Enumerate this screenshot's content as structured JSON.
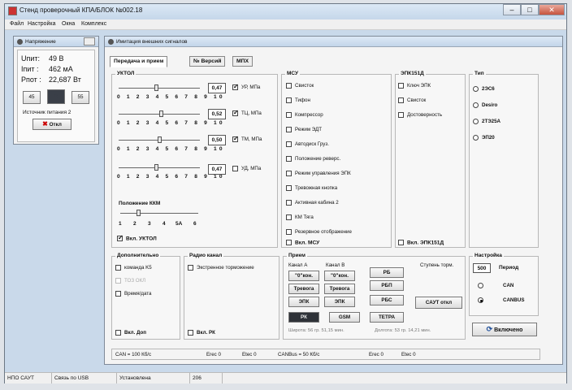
{
  "window": {
    "title": "Стенд проверочный КПА/БЛОК №002.18",
    "menu": [
      "Файл",
      "Настройка",
      "Окна",
      "Комплекс"
    ]
  },
  "power": {
    "title": "Напряжение",
    "u_label": "Uпит:",
    "u_value": "49 В",
    "i_label": "Iпит :",
    "i_value": "462 мА",
    "p_label": "Pпот :",
    "p_value": "22,687 Вт",
    "btn_45": "45",
    "btn_75": "75",
    "btn_55": "55",
    "source": "Источник питания 2",
    "off_button": "Откл"
  },
  "imitation": {
    "title": "Имитация внешних сигналов",
    "tabs": [
      "Передача и прием",
      "№ Версий",
      "МПХ"
    ],
    "uktol": {
      "title": "УКТОЛ",
      "ticks": "0 1 2 3 4 5 6 7 8 9 10",
      "sliders": [
        {
          "value": "0,47",
          "label": "УР, МПа",
          "checked": true
        },
        {
          "value": "0,52",
          "label": "ТЦ, МПа",
          "checked": true
        },
        {
          "value": "0,50",
          "label": "ТМ, МПа",
          "checked": true
        },
        {
          "value": "0,47",
          "label": "УД, МПа",
          "checked": false
        }
      ],
      "kkm_title": "Положение ККМ",
      "kkm_ticks": [
        "1",
        "2",
        "3",
        "4",
        "5А",
        "6"
      ],
      "enable": "Вкл. УКТОЛ"
    },
    "msu": {
      "title": "МСУ",
      "items": [
        "Свисток",
        "Тифон",
        "Компрессор",
        "Режим ЭДТ",
        "Автодиск Груз.",
        "Положение реверс.",
        "Режим управления ЭПК",
        "Тревожная кнопка",
        "Активная кабина 2",
        "КМ Тяга",
        "Резервное отображение"
      ],
      "enable": "Вкл. МСУ"
    },
    "epk": {
      "title": "ЭПК151Д",
      "items": [
        "Ключ ЭПК",
        "Свисток",
        "Достоверность"
      ],
      "enable": "Вкл. ЭПК151Д"
    },
    "type": {
      "title": "Тип",
      "items": [
        "2ЭС6",
        "Desiro",
        "2ТЭ25А",
        "ЭП20"
      ]
    },
    "extra": {
      "title": "Дополнительно",
      "items": [
        "команда K5",
        "ТОЗ ОКЛ",
        "Время/дата"
      ],
      "enable": "Вкл. Доп"
    },
    "radio": {
      "title": "Радио канал",
      "items": [
        "Экстренное торможение"
      ],
      "enable": "Вкл. РК"
    },
    "reception": {
      "title": "Прием",
      "channel_a": "Канал А",
      "channel_b": "Канал В",
      "buttons_a": [
        "\"0\"кон.",
        "Тревога",
        "ЭПК"
      ],
      "buttons_b": [
        "\"0\"кон.",
        "Тревога",
        "ЭПК"
      ],
      "buttons_c": [
        "РБ",
        "РБП",
        "РБС"
      ],
      "step_label": "Ступень торм.",
      "saut_button": "САУТ откл",
      "mode_buttons": [
        "РК",
        "GSM",
        "ТЕТРА"
      ],
      "lat": "Широта: 56 гр. 51,15 мин.",
      "lon": "Долгота: 53 гр. 14,21 мин."
    },
    "settings": {
      "title": "Настройка",
      "period_value": "500",
      "period_label": "Период",
      "can": "CAN",
      "canbus": "CANBUS",
      "enable_button": "Включено"
    },
    "info": {
      "can": "CAN = 100 Кб/с",
      "erec1": "Erec 0",
      "etec1": "Etec 0",
      "canbus": "CANBus = 50 Кб/с",
      "erec2": "Erec 0",
      "etec2": "Etec 0"
    }
  },
  "statusbar": [
    "НПО САУТ",
    "Связь по USB",
    "Установлена",
    "206"
  ]
}
